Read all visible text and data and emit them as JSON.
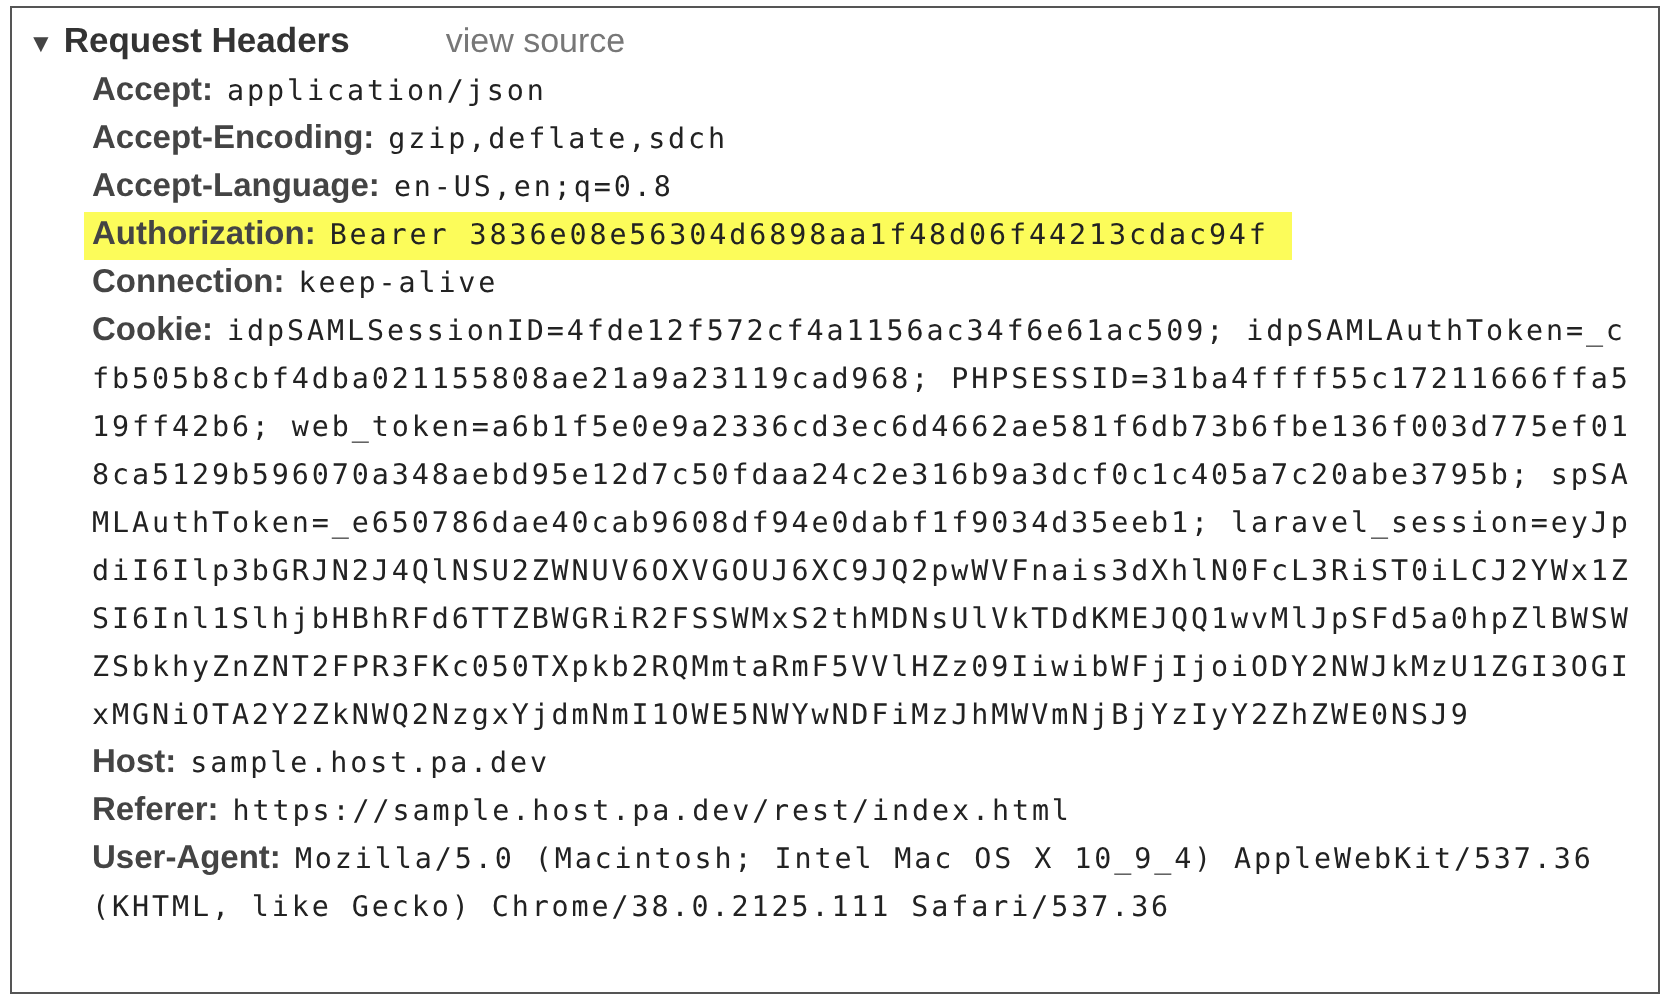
{
  "section": {
    "toggle": "▼",
    "title": "Request Headers",
    "expanded": true,
    "link": "view source"
  },
  "headers": [
    {
      "name": "Accept:",
      "value": "application/json",
      "highlighted": false
    },
    {
      "name": "Accept-Encoding:",
      "value": "gzip,deflate,sdch",
      "highlighted": false
    },
    {
      "name": "Accept-Language:",
      "value": "en-US,en;q=0.8",
      "highlighted": false
    },
    {
      "name": "Authorization:",
      "value": "Bearer 3836e08e56304d6898aa1f48d06f44213cdac94f",
      "highlighted": true
    },
    {
      "name": "Connection:",
      "value": "keep-alive",
      "highlighted": false
    },
    {
      "name": "Cookie:",
      "value": "idpSAMLSessionID=4fde12f572cf4a1156ac34f6e61ac509; idpSAMLAuthToken=_cfb505b8cbf4dba021155808ae21a9a23119cad968; PHPSESSID=31ba4ffff55c17211666ffa519ff42b6; web_token=a6b1f5e0e9a2336cd3ec6d4662ae581f6db73b6fbe136f003d775ef018ca5129b596070a348aebd95e12d7c50fdaa24c2e316b9a3dcf0c1c405a7c20abe3795b; spSAMLAuthToken=_e650786dae40cab9608df94e0dabf1f9034d35eeb1; laravel_session=eyJpdiI6Ilp3bGRJN2J4QlNSU2ZWNUV6OXVGOUJ6XC9JQ2pwWVFnais3dXhlN0FcL3RiST0iLCJ2YWx1ZSI6Inl1SlhjbHBhRFd6TTZBWGRiR2FSSWMxS2thMDNsUlVkTDdKMEJQQ1wvMlJpSFd5a0hpZlBWSWZSbkhyZnZNT2FPR3FKc050TXpkb2RQMmtaRmF5VVlHZz09IiwibWFjIjoiODY2NWJkMzU1ZGI3OGIxMGNiOTA2Y2ZkNWQ2NzgxYjdmNmI1OWE5NWYwNDFiMzJhMWVmNjBjYzIyY2ZhZWE0NSJ9",
      "highlighted": false
    },
    {
      "name": "Host:",
      "value": "sample.host.pa.dev",
      "highlighted": false
    },
    {
      "name": "Referer:",
      "value": "https://sample.host.pa.dev/rest/index.html",
      "highlighted": false
    },
    {
      "name": "User-Agent:",
      "value": "Mozilla/5.0 (Macintosh; Intel Mac OS X 10_9_4) AppleWebKit/537.36 (KHTML, like Gecko) Chrome/38.0.2125.111 Safari/537.36",
      "highlighted": false
    }
  ]
}
